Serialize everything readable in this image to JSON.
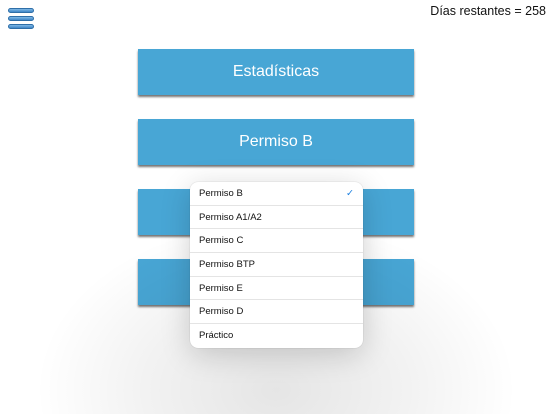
{
  "header": {
    "days_remaining": "Días restantes = 258"
  },
  "buttons": [
    {
      "label": "Estadísticas"
    },
    {
      "label": "Permiso B"
    },
    {
      "label": ""
    },
    {
      "label": ""
    }
  ],
  "dropdown": {
    "selected": "Permiso B",
    "options": [
      {
        "label": "Permiso B",
        "checked": "✓"
      },
      {
        "label": "Permiso A1/A2"
      },
      {
        "label": "Permiso C"
      },
      {
        "label": "Permiso BTP"
      },
      {
        "label": "Permiso E"
      },
      {
        "label": "Permiso D"
      },
      {
        "label": "Práctico"
      }
    ]
  },
  "colors": {
    "button_bg": "#48a6d5",
    "accent_check": "#1a7fe0"
  },
  "icons": {
    "menu": "hamburger-icon",
    "check": "checkmark-icon"
  }
}
